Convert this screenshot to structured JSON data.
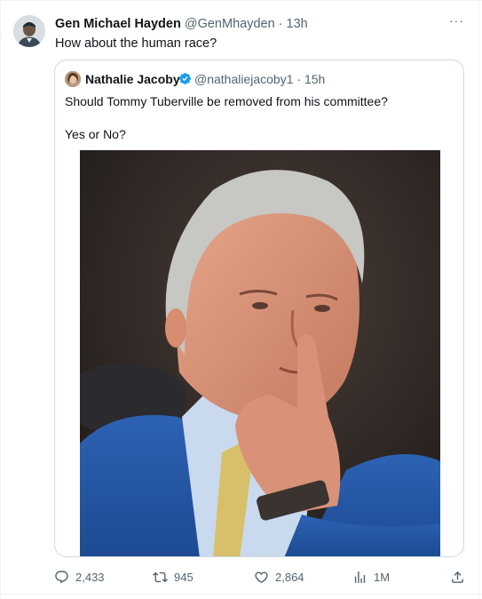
{
  "tweet": {
    "author_name": "Gen Michael Hayden",
    "author_handle": "@GenMhayden",
    "separator": "·",
    "time": "13h",
    "more_label": "···",
    "text": "How about the human race?"
  },
  "quote": {
    "author_name": "Nathalie Jacoby",
    "author_handle": "@nathaliejacoby1",
    "separator": "·",
    "time": "15h",
    "verified": true,
    "text_line1": "Should Tommy Tuberville be removed from his committee?",
    "text_line2": "Yes or No?"
  },
  "actions": {
    "replies": "2,433",
    "retweets": "945",
    "likes": "2,864",
    "views": "1M"
  },
  "colors": {
    "secondary_text": "#536471",
    "border": "#cfd9de",
    "verified_blue": "#1d9bf0"
  },
  "icons": [
    "more-icon",
    "verified-icon",
    "reply-icon",
    "retweet-icon",
    "like-icon",
    "views-icon",
    "share-icon"
  ]
}
